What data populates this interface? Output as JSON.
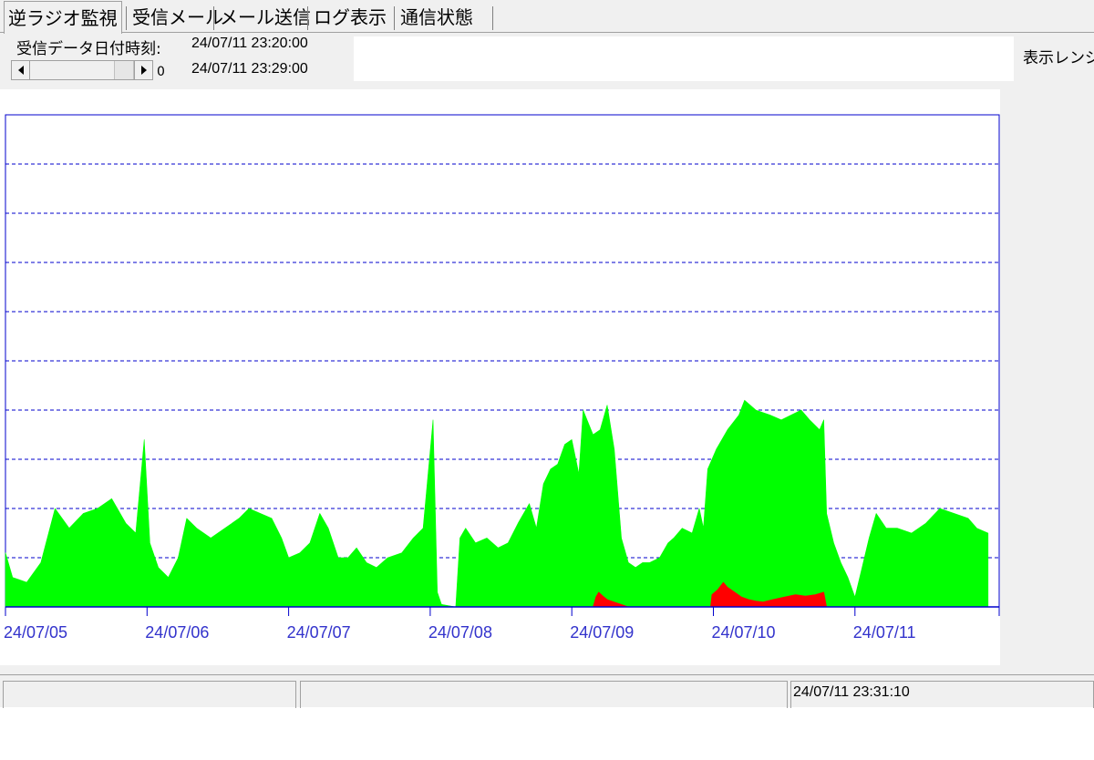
{
  "tabs": [
    {
      "label": "逆ラジオ監視",
      "active": true
    },
    {
      "label": "受信メール",
      "active": false
    },
    {
      "label": "メール送信",
      "active": false
    },
    {
      "label": "ログ表示",
      "active": false
    },
    {
      "label": "通信状態",
      "active": false
    }
  ],
  "header": {
    "received_label": "受信データ日付時刻:",
    "received_time": "24/07/11 23:20:00",
    "end_time": "24/07/11 23:29:00",
    "scroll_value": "0",
    "range_label": "表示レンジ"
  },
  "status": {
    "time": "24/07/11 23:31:10"
  },
  "colors": {
    "series_green": "#00ff00",
    "series_red": "#ff0000",
    "grid": "#0000cc",
    "tick_label": "#3333cc"
  },
  "chart_data": {
    "type": "area",
    "x_tick_labels": [
      "24/07/05",
      "24/07/06",
      "24/07/07",
      "24/07/08",
      "24/07/09",
      "24/07/10",
      "24/07/11"
    ],
    "x_range_days": [
      0,
      7
    ],
    "y_range": [
      0,
      10
    ],
    "grid": "horizontal dashed, 10 divisions",
    "series": [
      {
        "color": "green",
        "points": [
          [
            0.0,
            1.1
          ],
          [
            0.05,
            0.6
          ],
          [
            0.15,
            0.5
          ],
          [
            0.25,
            0.9
          ],
          [
            0.35,
            2.0
          ],
          [
            0.45,
            1.6
          ],
          [
            0.55,
            1.9
          ],
          [
            0.65,
            2.0
          ],
          [
            0.75,
            2.2
          ],
          [
            0.85,
            1.7
          ],
          [
            0.92,
            1.5
          ],
          [
            0.98,
            3.4
          ],
          [
            1.02,
            1.3
          ],
          [
            1.08,
            0.8
          ],
          [
            1.15,
            0.6
          ],
          [
            1.22,
            1.0
          ],
          [
            1.28,
            1.8
          ],
          [
            1.35,
            1.6
          ],
          [
            1.45,
            1.4
          ],
          [
            1.55,
            1.6
          ],
          [
            1.65,
            1.8
          ],
          [
            1.72,
            2.0
          ],
          [
            1.8,
            1.9
          ],
          [
            1.88,
            1.8
          ],
          [
            1.95,
            1.4
          ],
          [
            2.0,
            1.0
          ],
          [
            2.08,
            1.1
          ],
          [
            2.15,
            1.3
          ],
          [
            2.22,
            1.9
          ],
          [
            2.28,
            1.6
          ],
          [
            2.35,
            1.0
          ],
          [
            2.42,
            1.0
          ],
          [
            2.48,
            1.2
          ],
          [
            2.55,
            0.9
          ],
          [
            2.62,
            0.8
          ],
          [
            2.7,
            1.0
          ],
          [
            2.8,
            1.1
          ],
          [
            2.88,
            1.4
          ],
          [
            2.95,
            1.6
          ],
          [
            3.02,
            3.8
          ],
          [
            3.05,
            0.3
          ],
          [
            3.08,
            0.05
          ],
          [
            3.18,
            0.0
          ],
          [
            3.21,
            1.4
          ],
          [
            3.25,
            1.6
          ],
          [
            3.32,
            1.3
          ],
          [
            3.4,
            1.4
          ],
          [
            3.48,
            1.2
          ],
          [
            3.55,
            1.3
          ],
          [
            3.62,
            1.7
          ],
          [
            3.7,
            2.1
          ],
          [
            3.75,
            1.6
          ],
          [
            3.8,
            2.5
          ],
          [
            3.85,
            2.8
          ],
          [
            3.9,
            2.9
          ],
          [
            3.95,
            3.3
          ],
          [
            4.0,
            3.4
          ],
          [
            4.05,
            2.7
          ],
          [
            4.08,
            4.0
          ],
          [
            4.15,
            3.5
          ],
          [
            4.2,
            3.6
          ],
          [
            4.25,
            4.1
          ],
          [
            4.3,
            3.2
          ],
          [
            4.35,
            1.4
          ],
          [
            4.4,
            0.9
          ],
          [
            4.45,
            0.8
          ],
          [
            4.5,
            0.9
          ],
          [
            4.55,
            0.9
          ],
          [
            4.62,
            1.0
          ],
          [
            4.68,
            1.3
          ],
          [
            4.72,
            1.4
          ],
          [
            4.78,
            1.6
          ],
          [
            4.85,
            1.5
          ],
          [
            4.9,
            2.0
          ],
          [
            4.93,
            1.6
          ],
          [
            4.96,
            2.8
          ],
          [
            5.02,
            3.2
          ],
          [
            5.1,
            3.6
          ],
          [
            5.18,
            3.9
          ],
          [
            5.22,
            4.2
          ],
          [
            5.3,
            4.0
          ],
          [
            5.4,
            3.9
          ],
          [
            5.48,
            3.8
          ],
          [
            5.55,
            3.9
          ],
          [
            5.62,
            4.0
          ],
          [
            5.68,
            3.8
          ],
          [
            5.75,
            3.6
          ],
          [
            5.78,
            3.8
          ],
          [
            5.8,
            1.9
          ],
          [
            5.85,
            1.3
          ],
          [
            5.9,
            0.9
          ],
          [
            5.95,
            0.6
          ],
          [
            6.0,
            0.2
          ],
          [
            6.05,
            0.8
          ],
          [
            6.1,
            1.4
          ],
          [
            6.15,
            1.9
          ],
          [
            6.22,
            1.6
          ],
          [
            6.3,
            1.6
          ],
          [
            6.4,
            1.5
          ],
          [
            6.5,
            1.7
          ],
          [
            6.6,
            2.0
          ],
          [
            6.7,
            1.9
          ],
          [
            6.8,
            1.8
          ],
          [
            6.86,
            1.6
          ],
          [
            6.94,
            1.5
          ]
        ]
      },
      {
        "color": "red",
        "points": [
          [
            4.15,
            0.0
          ],
          [
            4.17,
            0.2
          ],
          [
            4.19,
            0.3
          ],
          [
            4.22,
            0.22
          ],
          [
            4.25,
            0.15
          ],
          [
            4.3,
            0.1
          ],
          [
            4.35,
            0.05
          ],
          [
            4.4,
            0.0
          ],
          [
            4.98,
            0.0
          ],
          [
            4.99,
            0.25
          ],
          [
            5.03,
            0.35
          ],
          [
            5.07,
            0.5
          ],
          [
            5.1,
            0.4
          ],
          [
            5.15,
            0.3
          ],
          [
            5.2,
            0.2
          ],
          [
            5.25,
            0.15
          ],
          [
            5.3,
            0.12
          ],
          [
            5.35,
            0.1
          ],
          [
            5.42,
            0.15
          ],
          [
            5.5,
            0.2
          ],
          [
            5.58,
            0.25
          ],
          [
            5.65,
            0.22
          ],
          [
            5.72,
            0.25
          ],
          [
            5.78,
            0.3
          ],
          [
            5.8,
            0.0
          ]
        ]
      }
    ]
  }
}
